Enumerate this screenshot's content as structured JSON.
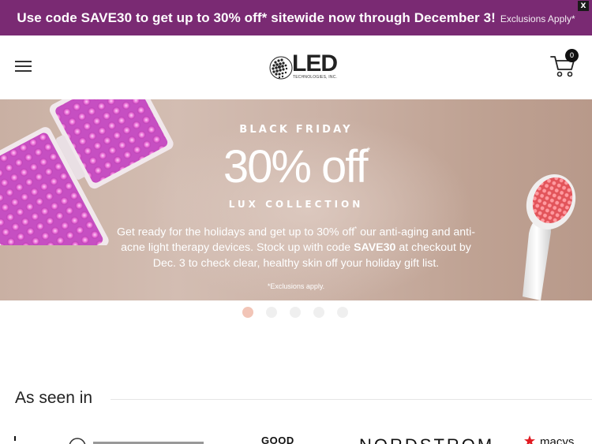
{
  "promo": {
    "main_text": "Use code SAVE30 to get up to 30% off* sitewide now through December 3!",
    "sub_text": "Exclusions Apply*",
    "close_label": "X",
    "bg_color": "#7a2a73"
  },
  "header": {
    "menu_icon": "hamburger-menu-icon",
    "logo_text": "LED",
    "logo_subtext": "TECHNOLOGIES, INC.",
    "cart_icon": "shopping-cart-icon",
    "cart_count": "0"
  },
  "hero": {
    "kicker": "BLACK FRIDAY",
    "headline": "30% off",
    "headline_mark": "*",
    "collection": "LUX COLLECTION",
    "body_part1": "Get ready for the holidays and get up to 30% off",
    "body_mark": "*",
    "body_part2": " our anti-aging and anti-acne light therapy devices. Stock up with code ",
    "body_code": "SAVE30",
    "body_part3": " at checkout by Dec. 3 to check clear, healthy skin off your holiday gift list.",
    "fine_print": "*Exclusions apply.",
    "accent_color": "#f2c5b7"
  },
  "carousel": {
    "slides": 5,
    "active_index": 0
  },
  "as_seen_in": {
    "title": "As seen in",
    "logos": [
      "GOOD",
      "NORDSTROM",
      "macys"
    ]
  }
}
